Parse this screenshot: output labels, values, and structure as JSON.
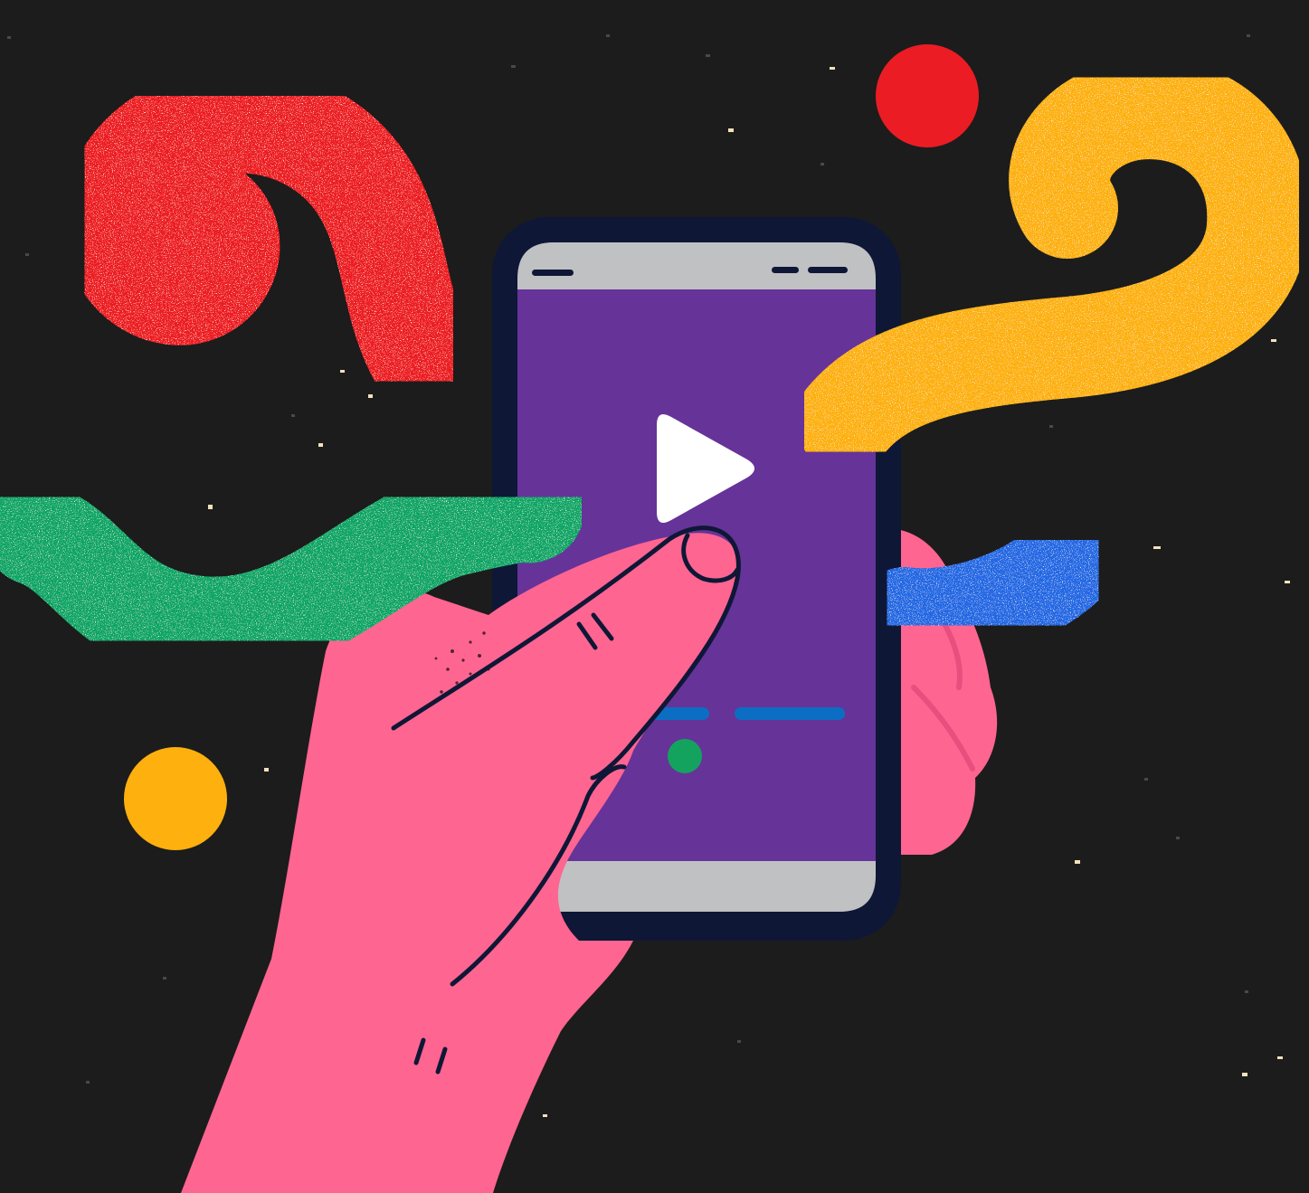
{
  "illustration": {
    "subject": "hand-holding-smartphone-with-play-button",
    "colors": {
      "background": "#1c1c1c",
      "red": "#ec1c24",
      "yellow": "#fdb00e",
      "green": "#0aa566",
      "blue": "#2368e5",
      "skin": "#ff6591",
      "phone_frame": "#0f1736",
      "phone_screen": "#663399",
      "phone_bars": "#c0c1c3",
      "play_icon": "#ffffff",
      "progress_bar": "#0b6ec2",
      "dot_green": "#14a35f",
      "speckle": "#f6e5c4"
    },
    "icons": [
      "play-icon",
      "status-bar",
      "navigation-bar",
      "progress-indicator"
    ]
  }
}
